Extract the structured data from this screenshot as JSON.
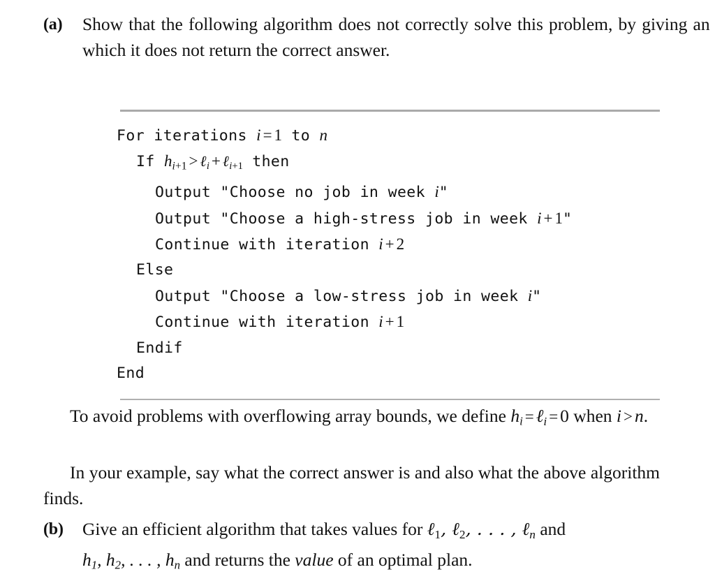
{
  "document": {
    "items": [
      {
        "label": "(a)",
        "text": "Show that the following algorithm does not correctly solve this problem, by giving an instance on which it does not return the correct answer."
      },
      {
        "label": "(b)",
        "text_part1": "Give an efficient algorithm that takes values for ",
        "math1": "ℓ₁, ℓ₂, … , ℓₙ",
        "text_part2": " and ",
        "math2": "h₁, h₂, … , hₙ",
        "text_part3": " and returns the ",
        "emphasis": "value",
        "text_part4": " of an optimal plan."
      }
    ],
    "algorithm": {
      "lines": [
        {
          "indent": 0,
          "code": "For iterations ",
          "math": "i  =  1",
          "code2": " to ",
          "math2": "n",
          "display": "For iterations i = 1 to n"
        },
        {
          "indent": 1,
          "code": "If ",
          "math": "h(i+1) > ℓ(i) + ℓ(i+1)",
          "code2": " then",
          "display": "If h_{i+1} > ℓ_i + ℓ_{i+1} then"
        },
        {
          "indent": 2,
          "display": "Output \"Choose no job in week i\""
        },
        {
          "indent": 2,
          "display": "Output \"Choose a high-stress job in week i+1\""
        },
        {
          "indent": 2,
          "display": "Continue with iteration i+2"
        },
        {
          "indent": 1,
          "display": "Else"
        },
        {
          "indent": 2,
          "display": "Output \"Choose a low-stress job in week i\""
        },
        {
          "indent": 2,
          "display": "Continue with iteration i+1"
        },
        {
          "indent": 1,
          "display": "Endif"
        },
        {
          "indent": 0,
          "display": "End"
        }
      ]
    },
    "paragraphs": [
      {
        "id": "overflow-note",
        "text": "To avoid problems with overflowing array bounds, we define hᵢ = ℓᵢ = 0 when i > n."
      },
      {
        "id": "example-note",
        "text": "In your example, say what the correct answer is and also what the above algorithm finds."
      }
    ]
  },
  "colors": {
    "text": "#111111",
    "rule": "#aaaaaa",
    "background": "#ffffff"
  }
}
